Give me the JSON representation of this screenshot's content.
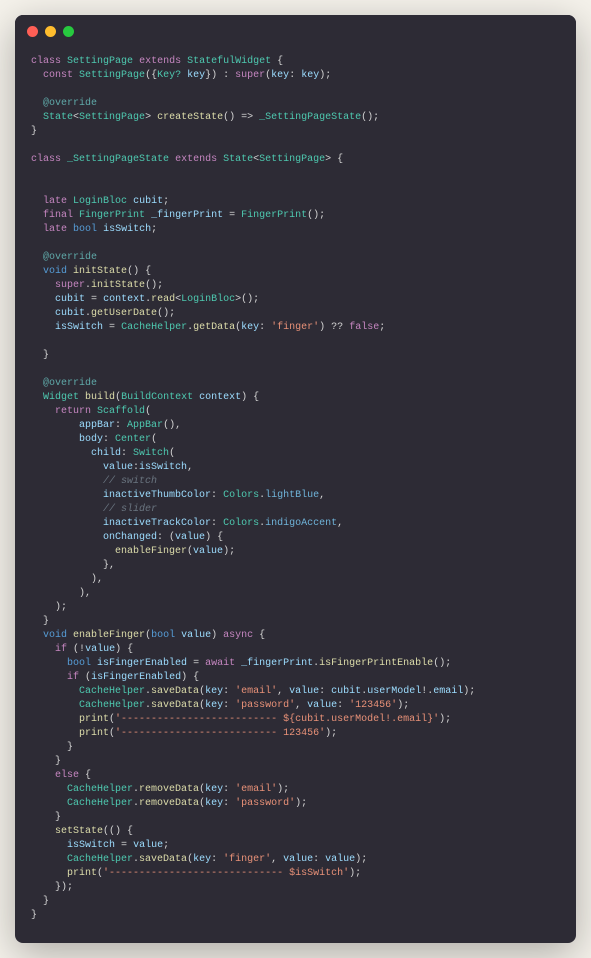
{
  "window": {
    "buttons": {
      "close": "close",
      "minimize": "minimize",
      "maximize": "maximize"
    }
  },
  "code": {
    "l1_class": "class",
    "l1_name": "SettingPage",
    "l1_extends": "extends",
    "l1_parent": "StatefulWidget",
    "l2_const": "const",
    "l2_ctor": "SettingPage",
    "l2_key_type": "Key?",
    "l2_key": "key",
    "l2_super": "super",
    "l2_key2": "key",
    "l2_key3": "key",
    "l3_annot": "@override",
    "l4_state": "State",
    "l4_gen": "SettingPage",
    "l4_create": "createState",
    "l4_impl": "_SettingPageState",
    "l5_class": "class",
    "l5_name": "_SettingPageState",
    "l5_extends": "extends",
    "l5_state": "State",
    "l5_gen": "SettingPage",
    "l6_late": "late",
    "l6_type": "LoginBloc",
    "l6_var": "cubit",
    "l7_final": "final",
    "l7_type": "FingerPrint",
    "l7_var": "_fingerPrint",
    "l7_ctor": "FingerPrint",
    "l8_late": "late",
    "l8_type": "bool",
    "l8_var": "isSwitch",
    "l9_annot": "@override",
    "l10_void": "void",
    "l10_fn": "initState",
    "l11_super": "super",
    "l11_init": "initState",
    "l12_cubit": "cubit",
    "l12_ctx": "context",
    "l12_read": "read",
    "l12_bloc": "LoginBloc",
    "l13_cubit": "cubit",
    "l13_fn": "getUserDate",
    "l14_var": "isSwitch",
    "l14_cls": "CacheHelper",
    "l14_fn": "getData",
    "l14_key": "key",
    "l14_str": "'finger'",
    "l14_false": "false",
    "l15_annot": "@override",
    "l16_type": "Widget",
    "l16_fn": "build",
    "l16_ctx_type": "BuildContext",
    "l16_ctx": "context",
    "l17_return": "return",
    "l17_scaffold": "Scaffold",
    "l18_appbar": "appBar",
    "l18_appbar_cls": "AppBar",
    "l19_body": "body",
    "l19_center": "Center",
    "l20_child": "child",
    "l20_switch": "Switch",
    "l21_value": "value",
    "l21_isswitch": "isSwitch",
    "l22_cmt": "// switch",
    "l23_prop": "inactiveThumbColor",
    "l23_colors": "Colors",
    "l23_lb": "lightBlue",
    "l24_cmt": "// slider",
    "l25_prop": "inactiveTrackColor",
    "l25_colors": "Colors",
    "l25_ia": "indigoAccent",
    "l26_onch": "onChanged",
    "l26_val": "value",
    "l27_fn": "enableFinger",
    "l27_val": "value",
    "l28_void": "void",
    "l28_fn": "enableFinger",
    "l28_bool": "bool",
    "l28_val": "value",
    "l28_async": "async",
    "l29_if": "if",
    "l29_val": "value",
    "l30_bool": "bool",
    "l30_var": "isFingerEnabled",
    "l30_await": "await",
    "l30_fp": "_fingerPrint",
    "l30_fn": "isFingerPrintEnable",
    "l31_if": "if",
    "l31_var": "isFingerEnabled",
    "l32_cls": "CacheHelper",
    "l32_fn": "saveData",
    "l32_key": "key",
    "l32_str1": "'email'",
    "l32_val": "value",
    "l32_cubit": "cubit",
    "l32_um": "userModel",
    "l32_email": "email",
    "l33_cls": "CacheHelper",
    "l33_fn": "saveData",
    "l33_key": "key",
    "l33_str1": "'password'",
    "l33_val": "value",
    "l33_str2": "'123456'",
    "l34_print": "print",
    "l34_str": "'-------------------------- ${cubit.userModel!.email}'",
    "l35_print": "print",
    "l35_str": "'-------------------------- 123456'",
    "l36_else": "else",
    "l37_cls": "CacheHelper",
    "l37_fn": "removeData",
    "l37_key": "key",
    "l37_str": "'email'",
    "l38_cls": "CacheHelper",
    "l38_fn": "removeData",
    "l38_key": "key",
    "l38_str": "'password'",
    "l39_fn": "setState",
    "l40_var": "isSwitch",
    "l40_val": "value",
    "l41_cls": "CacheHelper",
    "l41_fn": "saveData",
    "l41_key": "key",
    "l41_str": "'finger'",
    "l41_val": "value",
    "l41_val2": "value",
    "l42_print": "print",
    "l42_str": "'----------------------------- $isSwitch'"
  }
}
